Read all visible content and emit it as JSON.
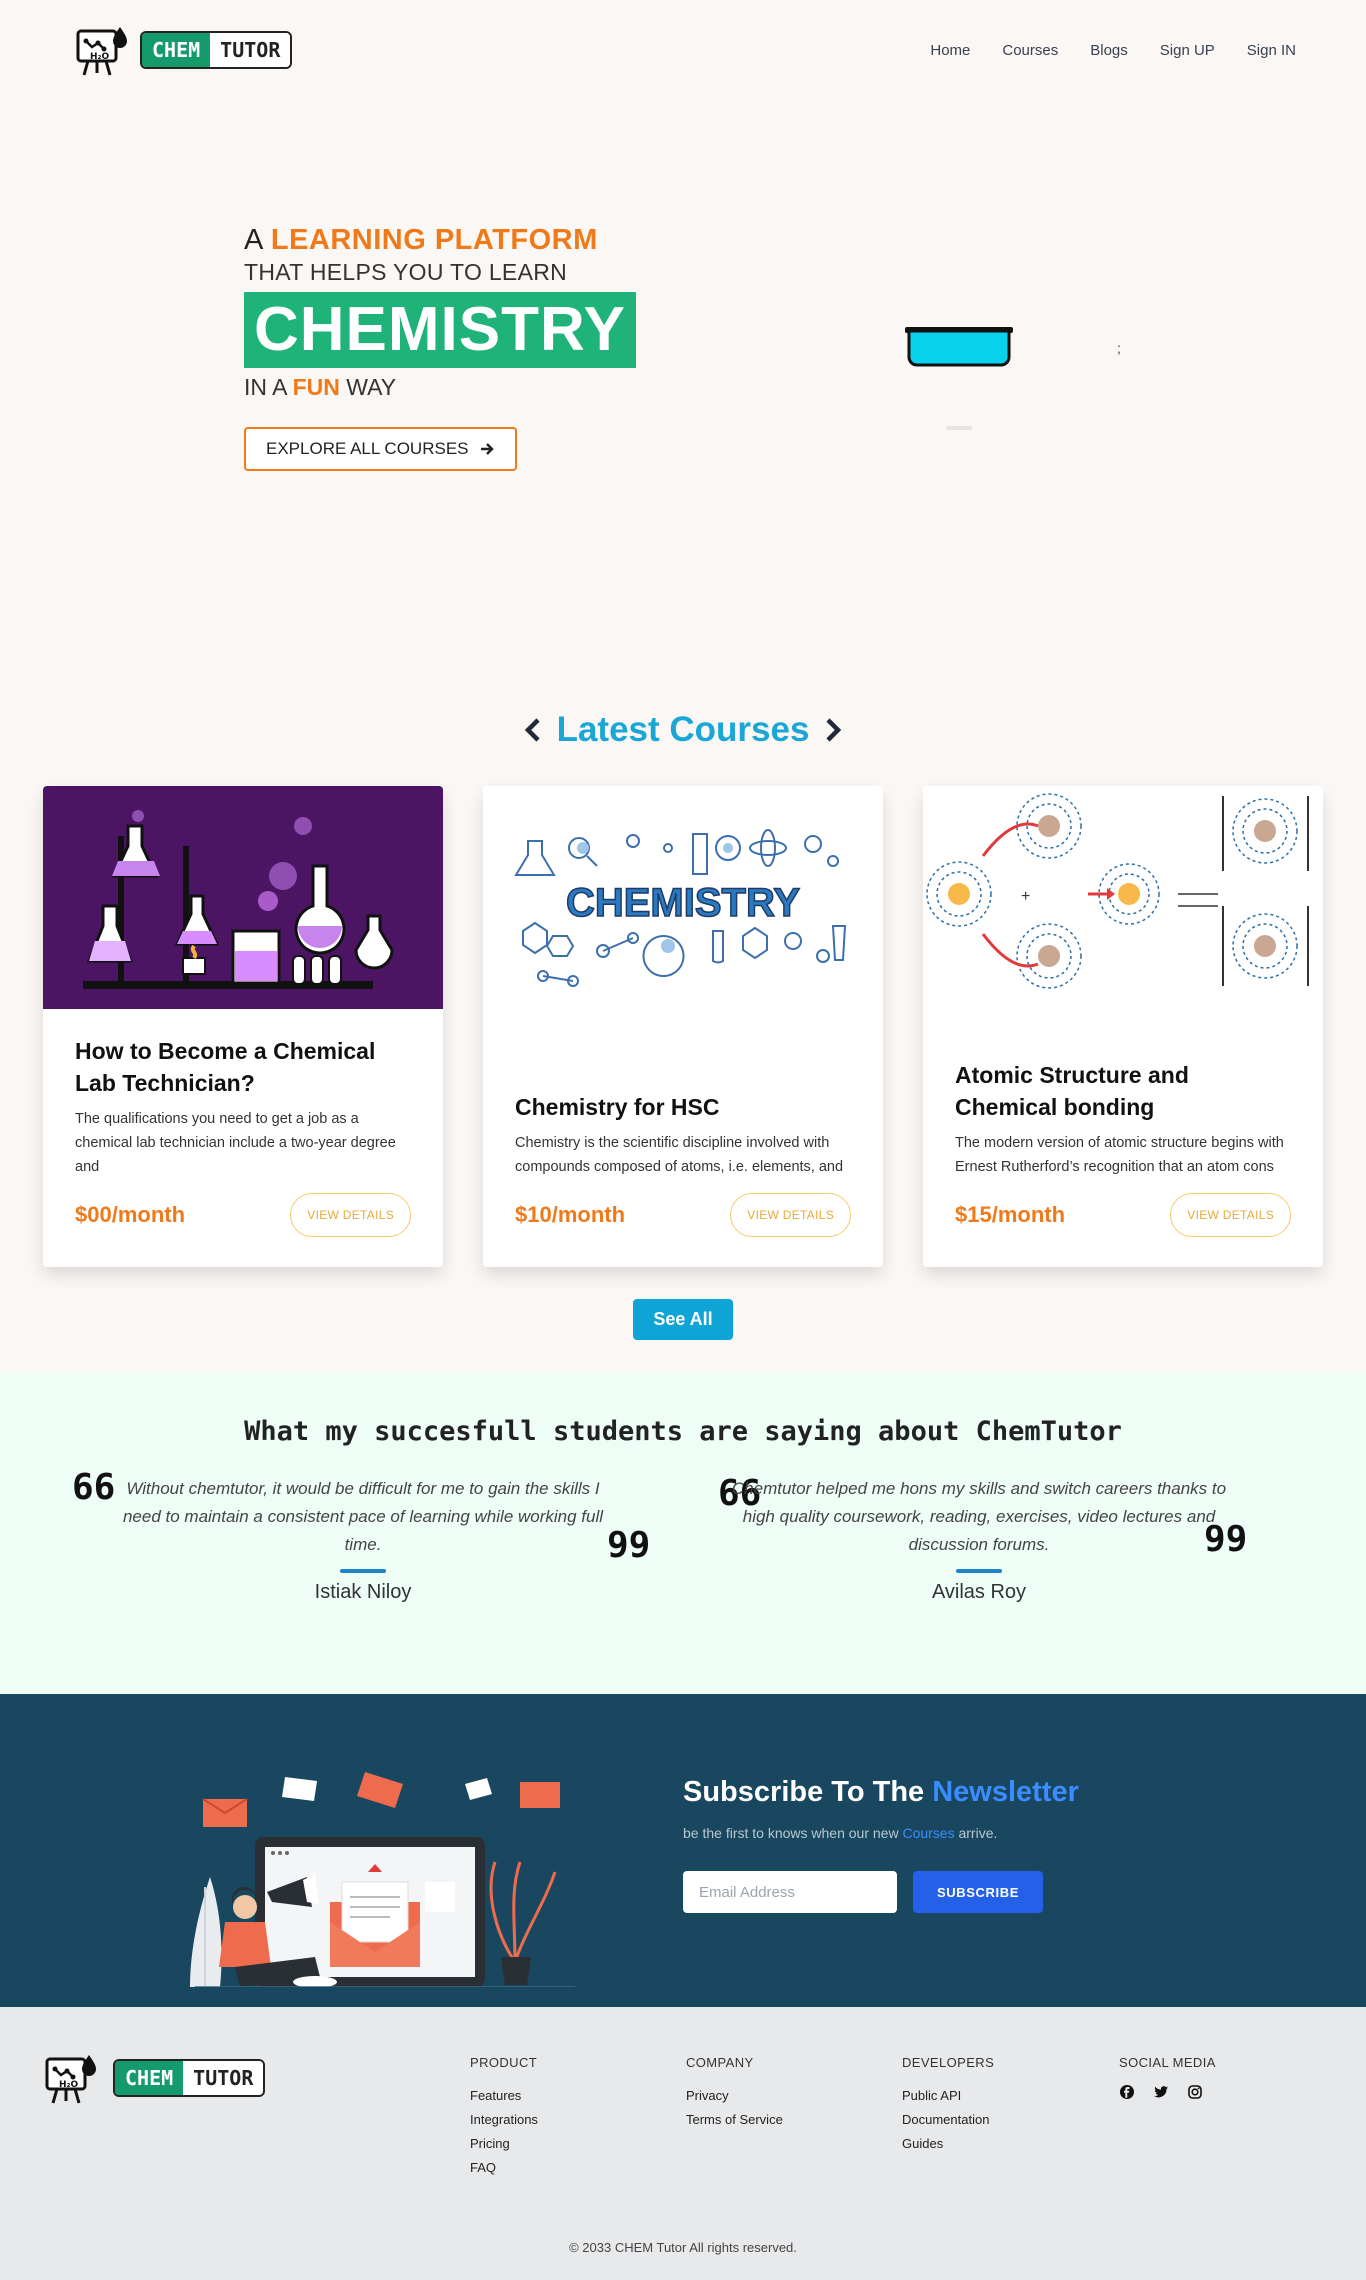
{
  "brand": {
    "left": "CHEM",
    "right": "TUTOR",
    "logo_icon": "h2o-flask-icon"
  },
  "nav": {
    "links": [
      "Home",
      "Courses",
      "Blogs",
      "Sign UP",
      "Sign IN"
    ]
  },
  "hero": {
    "line1_prefix": "A",
    "line1_accent": "LEARNING PLATFORM",
    "line2": "THAT HELPS YOU TO LEARN",
    "big_word": "CHEMISTRY",
    "line3_prefix": "IN A",
    "line3_accent": "FUN",
    "line3_suffix": "WAY",
    "cta_label": "EXPLORE ALL COURSES",
    "cta_icon": "arrow-right-icon",
    "stray_text": ";"
  },
  "courses": {
    "title": "Latest Courses",
    "prev_icon": "chevron-left-icon",
    "next_icon": "chevron-right-icon",
    "items": [
      {
        "title": "How to Become a Chemical Lab Technician?",
        "desc": "The qualifications you need to get a job as a chemical lab technician include a two-year degree and",
        "price": "$00",
        "per": "/month",
        "button": "VIEW DETAILS"
      },
      {
        "title": "Chemistry for HSC",
        "desc": "Chemistry is the scientific discipline involved with compounds composed of atoms, i.e. elements, and",
        "price": "$10",
        "per": "/month",
        "button": "VIEW DETAILS",
        "image_text": "CHEMISTRY"
      },
      {
        "title": "Atomic Structure and Chemical bonding",
        "desc": "The modern version of atomic structure begins with Ernest Rutherford’s recognition that an atom cons",
        "price": "$15",
        "per": "/month",
        "button": "VIEW DETAILS"
      }
    ],
    "see_all": "See All"
  },
  "testimonials": {
    "title": "What my succesfull students are saying about ChemTutor",
    "items": [
      {
        "text": "Without chemtutor, it would be difficult for me to gain the skills I need to maintain a consistent pace of learning while working full time.",
        "name": "Istiak Niloy"
      },
      {
        "text": "Chemtutor helped me hons my skills and switch careers thanks to high quality coursework, reading, exercises, video lectures and discussion forums.",
        "name": "Avilas Roy"
      }
    ],
    "open_quote": "66",
    "close_quote": "99"
  },
  "newsletter": {
    "title_prefix": "Subscribe To The",
    "title_accent": "Newsletter",
    "sub_prefix": "be the first to knows when our new",
    "sub_accent": "Courses",
    "sub_suffix": "arrive.",
    "email_placeholder": "Email Address",
    "button": "SUBSCRIBE"
  },
  "footer": {
    "columns": [
      {
        "heading": "PRODUCT",
        "links": [
          "Features",
          "Integrations",
          "Pricing",
          "FAQ"
        ]
      },
      {
        "heading": "COMPANY",
        "links": [
          "Privacy",
          "Terms of Service"
        ]
      },
      {
        "heading": "DEVELOPERS",
        "links": [
          "Public API",
          "Documentation",
          "Guides"
        ]
      }
    ],
    "social_heading": "SOCIAL MEDIA",
    "social_icons": [
      "facebook-icon",
      "twitter-icon",
      "instagram-icon"
    ],
    "copyright": "© 2033 CHEM Tutor All rights reserved."
  },
  "colors": {
    "orange": "#f07a1a",
    "green": "#1fb37a",
    "cyan": "#1aa7d6",
    "navy": "#19475f",
    "blue": "#2560e8"
  }
}
